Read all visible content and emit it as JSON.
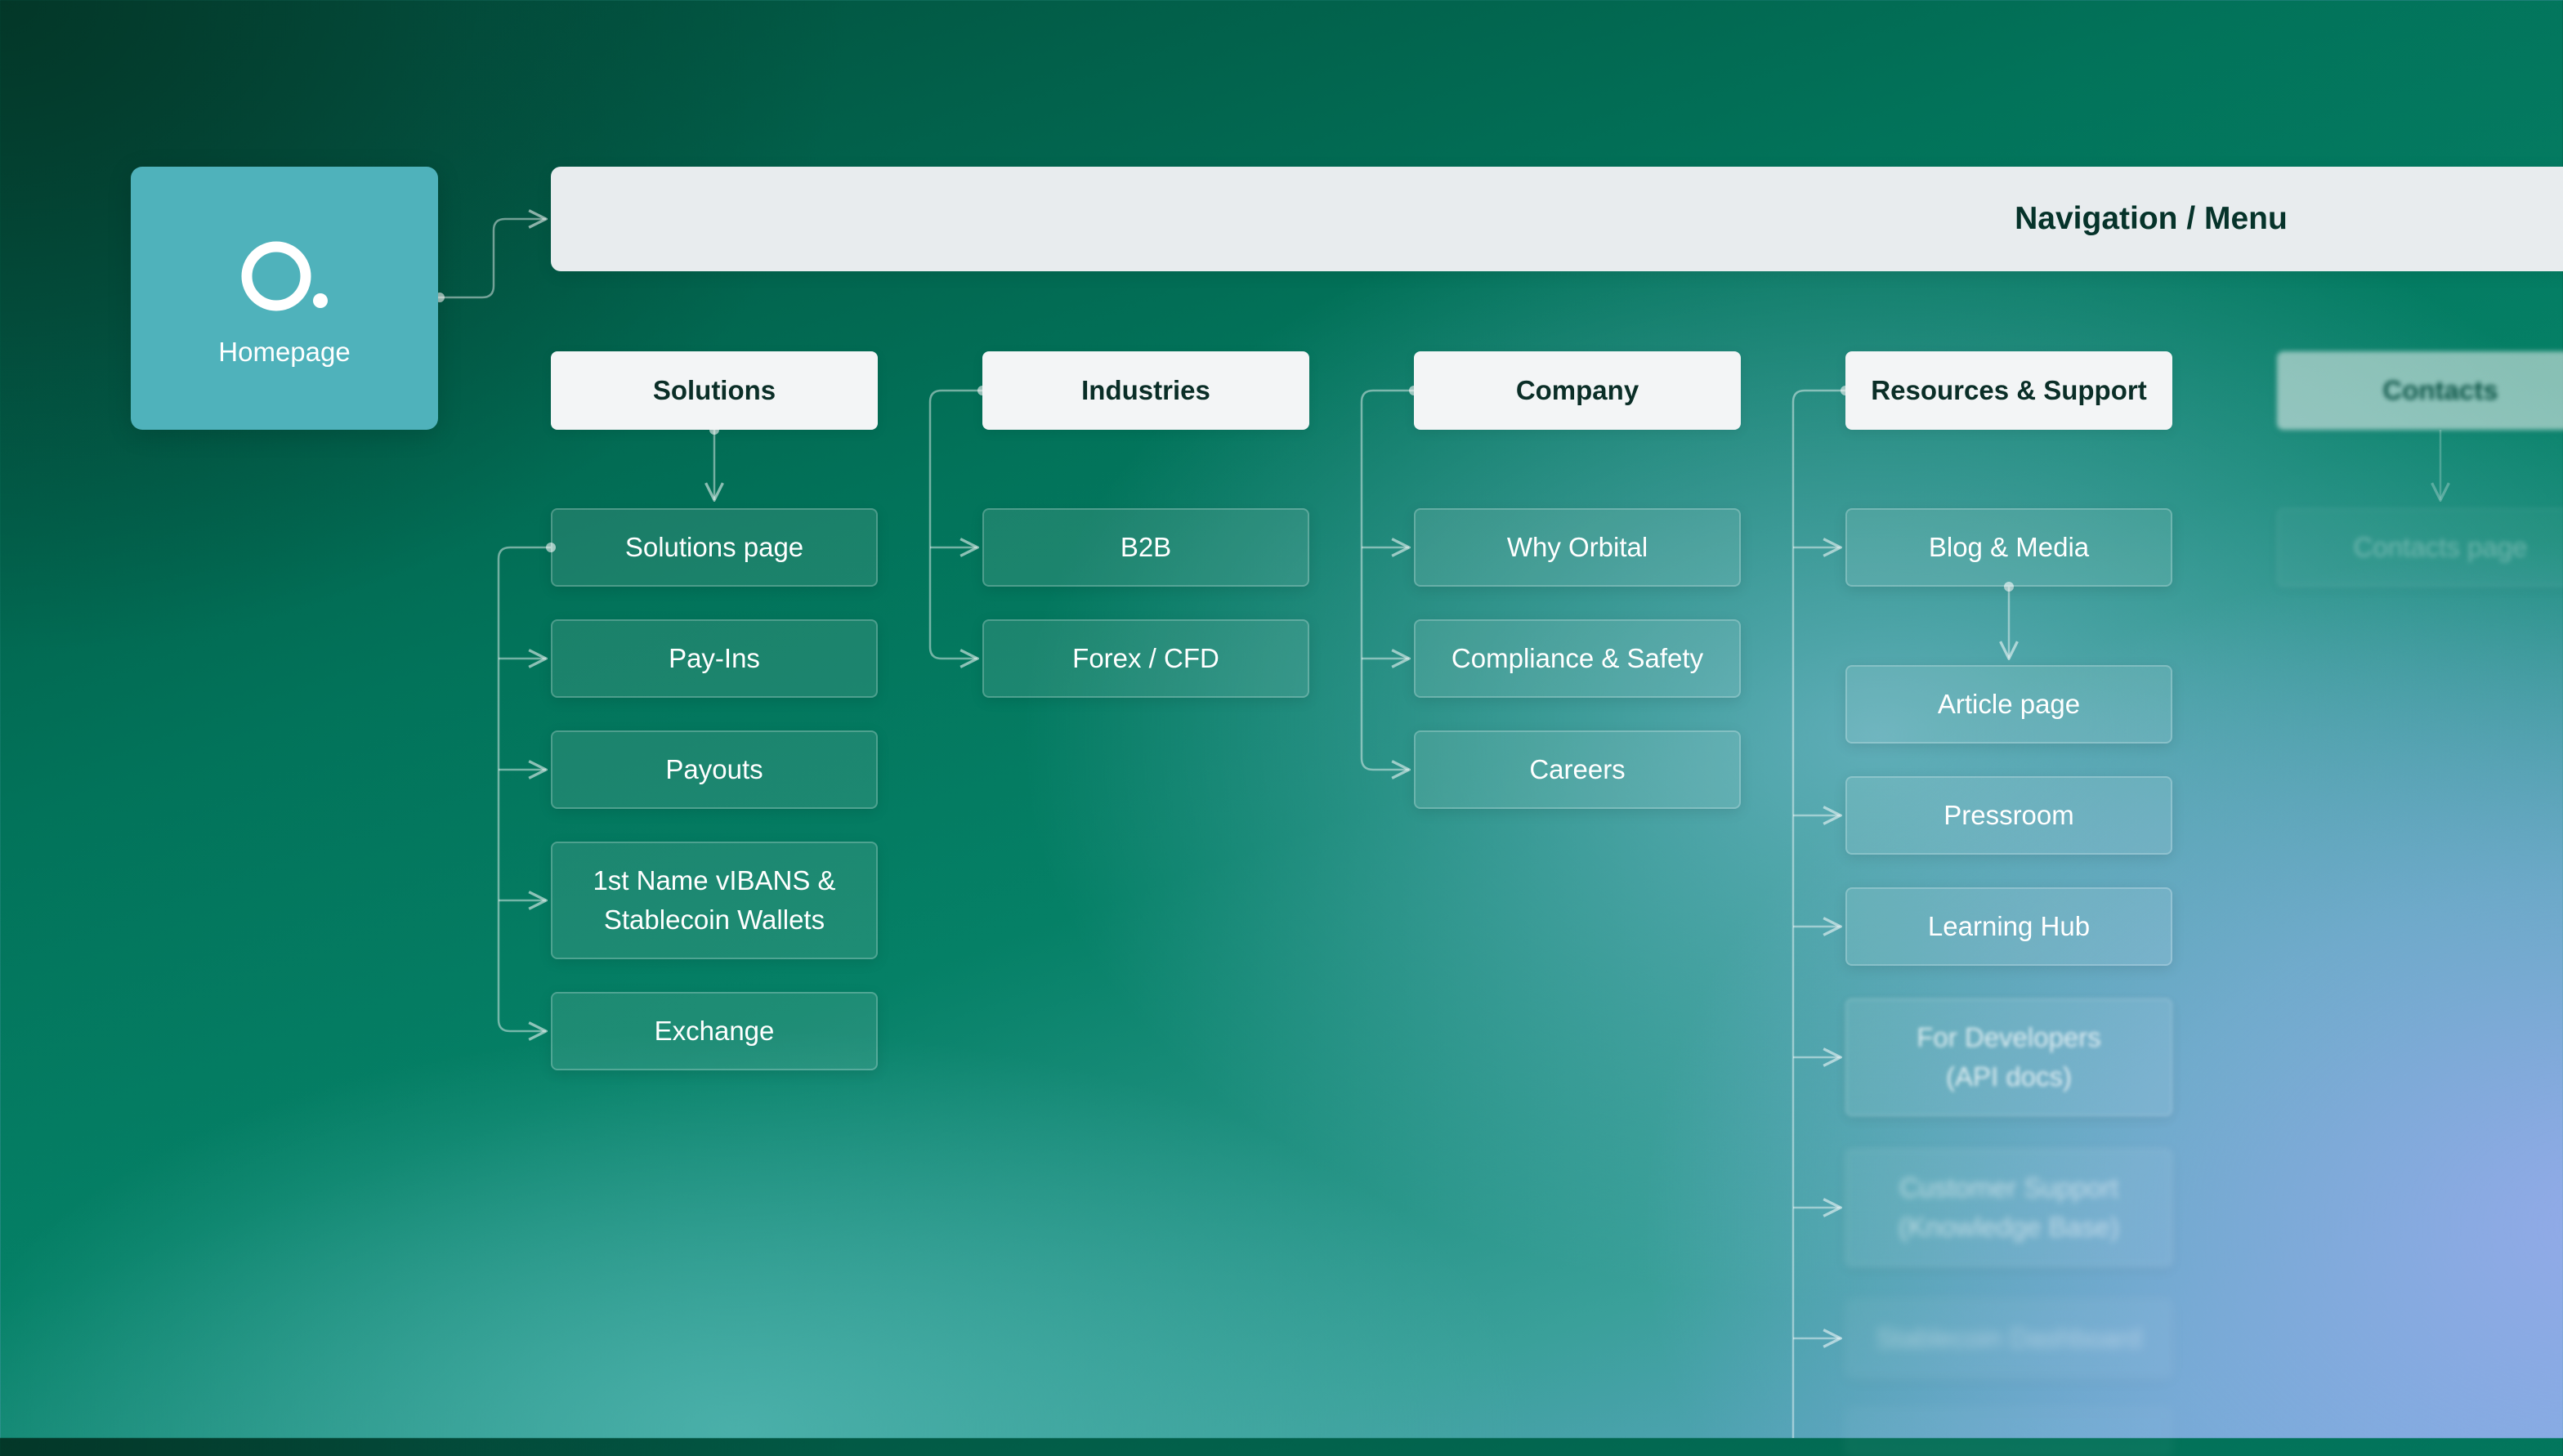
{
  "homepage": {
    "label": "Homepage",
    "logo_icon": "orbital-logo-icon"
  },
  "navigation": {
    "title": "Navigation / Menu"
  },
  "columns": {
    "solutions": {
      "title": "Solutions",
      "items": [
        "Solutions page",
        "Pay-Ins",
        "Payouts",
        "1st Name vIBANS &\nStablecoin Wallets",
        "Exchange"
      ]
    },
    "industries": {
      "title": "Industries",
      "items": [
        "B2B",
        "Forex / CFD"
      ]
    },
    "company": {
      "title": "Company",
      "items": [
        "Why Orbital",
        "Compliance & Safety",
        "Careers"
      ]
    },
    "resources": {
      "title": "Resources & Support",
      "items": [
        "Blog & Media",
        "Article page",
        "Pressroom",
        "Learning Hub",
        "For Developers\n(API docs)",
        "Customer Support\n(Knowledge Base)",
        "Stablecoin Dashboard"
      ]
    },
    "contacts": {
      "title": "Contacts",
      "items": [
        "Contacts page"
      ]
    }
  },
  "colors": {
    "homepage_tile": "#4fb2bb",
    "navbar": "#e8ecee",
    "header_card": "#f3f5f6",
    "connector": "rgba(255,255,255,0.45)"
  }
}
